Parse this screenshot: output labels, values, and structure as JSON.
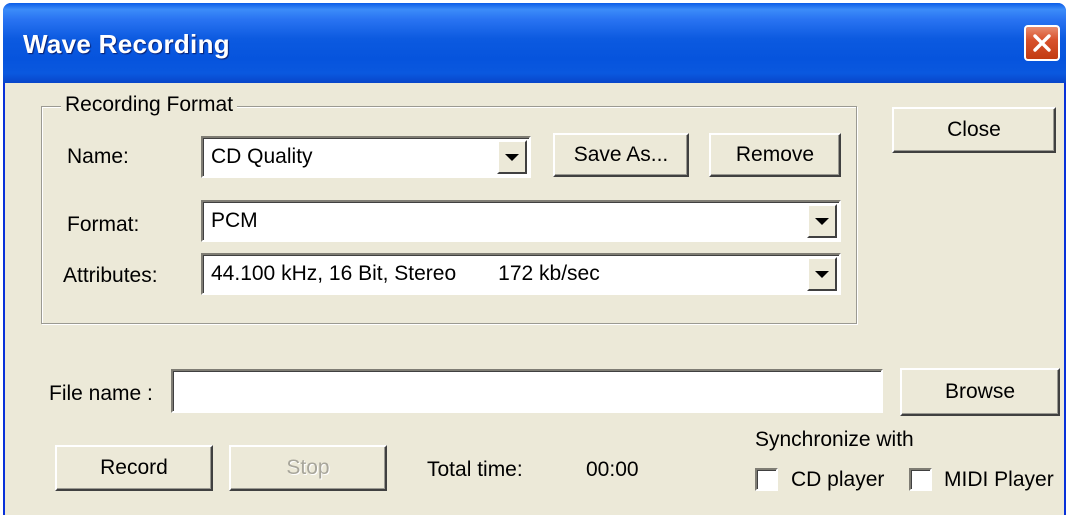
{
  "window": {
    "title": "Wave Recording"
  },
  "recording_format": {
    "group_label": "Recording Format",
    "name_label": "Name:",
    "name_value": "CD Quality",
    "save_as_label": "Save As...",
    "remove_label": "Remove",
    "format_label": "Format:",
    "format_value": "PCM",
    "attributes_label": "Attributes:",
    "attributes_value": "44.100 kHz, 16 Bit, Stereo",
    "attributes_rate": "172 kb/sec"
  },
  "close_label": "Close",
  "file": {
    "label": "File name :",
    "value": "",
    "browse_label": "Browse"
  },
  "controls": {
    "record_label": "Record",
    "stop_label": "Stop",
    "stop_enabled": false,
    "total_time_label": "Total time:",
    "total_time_value": "00:00"
  },
  "sync": {
    "label": "Synchronize with",
    "cd_player_label": "CD player",
    "cd_player_checked": false,
    "midi_player_label": "MIDI Player",
    "midi_player_checked": false
  },
  "colors": {
    "title_bar": "#0654DD",
    "dialog_face": "#ECE9D8",
    "close_button": "#D8522C",
    "disabled_text": "#A8A69B"
  },
  "icons": {
    "close": "close-x-icon",
    "dropdown": "chevron-down-icon"
  }
}
